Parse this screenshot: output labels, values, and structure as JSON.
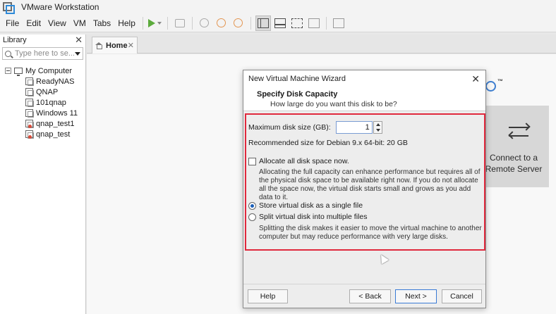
{
  "window": {
    "title": "VMware Workstation"
  },
  "menu": {
    "items": [
      "File",
      "Edit",
      "View",
      "VM",
      "Tabs",
      "Help"
    ]
  },
  "toolbar": {
    "icons": [
      "power-on-icon",
      "dropdown-icon",
      "send-keys-icon",
      "snapshot-icon",
      "revert-snapshot-icon",
      "manage-snapshots-icon",
      "show-library-icon",
      "thumbnail-bar-icon",
      "full-screen-icon",
      "unity-icon",
      "console-view-icon"
    ],
    "accent_play": "#5cab3c"
  },
  "library": {
    "title": "Library",
    "close_glyph": "✕",
    "search_placeholder": "Type here to se...",
    "root": "My Computer",
    "items": [
      {
        "label": "ReadyNAS",
        "shared": false
      },
      {
        "label": "QNAP",
        "shared": false
      },
      {
        "label": "101qnap",
        "shared": false
      },
      {
        "label": "Windows 11",
        "shared": false
      },
      {
        "label": "qnap_test1",
        "shared": true
      },
      {
        "label": "qnap_test",
        "shared": true
      }
    ]
  },
  "tabs": [
    {
      "label": "Home",
      "close_glyph": "✕",
      "active": true
    }
  ],
  "home": {
    "logo_suffix": "™",
    "remote_card_line1": "Connect to a",
    "remote_card_line2": "Remote Server"
  },
  "dialog": {
    "title": "New Virtual Machine Wizard",
    "close_glyph": "✕",
    "heading": "Specify Disk Capacity",
    "subheading": "How large do you want this disk to be?",
    "max_size_label": "Maximum disk size (GB):",
    "max_size_value": "1",
    "recommended": "Recommended size for Debian 9.x 64-bit: 20 GB",
    "allocate_label": "Allocate all disk space now.",
    "allocate_checked": false,
    "allocate_help": "Allocating the full capacity can enhance performance but requires all of the physical disk space to be available right now. If you do not allocate all the space now, the virtual disk starts small and grows as you add data to it.",
    "option_single": "Store virtual disk as a single file",
    "option_multiple": "Split virtual disk into multiple files",
    "selected_option": "single",
    "split_help": "Splitting the disk makes it easier to move the virtual machine to another computer but may reduce performance with very large disks.",
    "buttons": {
      "help": "Help",
      "back": "< Back",
      "next": "Next >",
      "cancel": "Cancel"
    },
    "highlight_color": "#e0293d"
  }
}
